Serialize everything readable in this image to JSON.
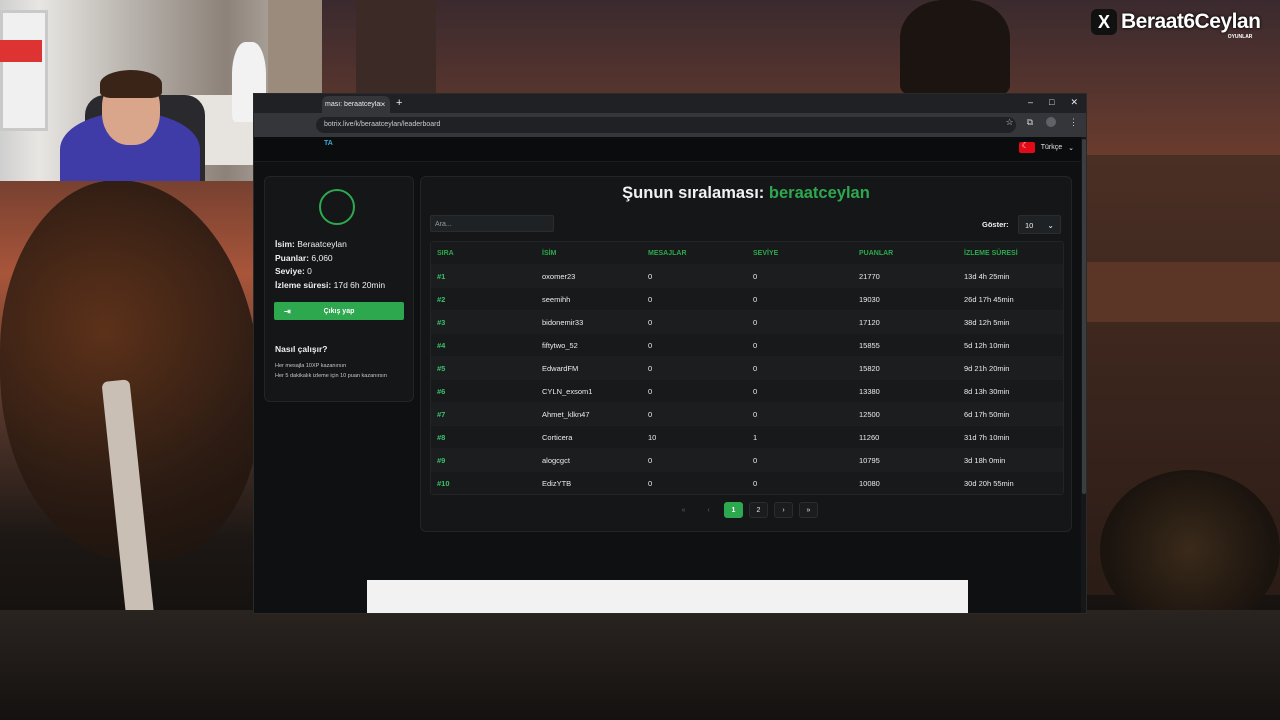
{
  "watermark": {
    "logo": "X",
    "handle": "Beraat6Ceylan",
    "sub": "OYUNLAR"
  },
  "browser": {
    "tab_title": "ması: beraatceylan",
    "tab_close": "×",
    "new_tab": "+",
    "window_controls": [
      "–",
      "□",
      "✕"
    ],
    "url": "botrix.live/k/beraatceylan/leaderboard"
  },
  "topnav": {
    "brand_fragment": "TA",
    "language": "Türkçe"
  },
  "profile": {
    "name_label": "İsim:",
    "name_value": "Beraatceylan",
    "points_label": "Puanlar:",
    "points_value": "6,060",
    "level_label": "Seviye:",
    "level_value": "0",
    "watch_label": "İzleme süresi:",
    "watch_value": "17d 6h 20min",
    "logout_label": "Çıkış yap"
  },
  "how": {
    "title": "Nasıl çalışır?",
    "lines": [
      "Her mesajla 10XP kazanırsın",
      "Her 5 dakikalık izleme için 10 puan kazanırsın"
    ]
  },
  "leaderboard": {
    "title_prefix": "Şunun sıralaması:",
    "title_channel": "beraatceylan",
    "search_placeholder": "Ara...",
    "show_label": "Göster:",
    "show_value": "10",
    "columns": [
      "SIRA",
      "İSİM",
      "MESAJLAR",
      "SEVİYE",
      "PUANLAR",
      "İZLEME SÜRESİ"
    ],
    "rows": [
      [
        "#1",
        "oxomer23",
        "0",
        "0",
        "21770",
        "13d 4h 25min"
      ],
      [
        "#2",
        "seemihh",
        "0",
        "0",
        "19030",
        "26d 17h 45min"
      ],
      [
        "#3",
        "bidonemir33",
        "0",
        "0",
        "17120",
        "38d 12h 5min"
      ],
      [
        "#4",
        "fiftytwo_52",
        "0",
        "0",
        "15855",
        "5d 12h 10min"
      ],
      [
        "#5",
        "EdwardFM",
        "0",
        "0",
        "15820",
        "9d 21h 20min"
      ],
      [
        "#6",
        "CYLN_exsom1",
        "0",
        "0",
        "13380",
        "8d 13h 30min"
      ],
      [
        "#7",
        "Ahmet_klkn47",
        "0",
        "0",
        "12500",
        "6d 17h 50min"
      ],
      [
        "#8",
        "Corticera",
        "10",
        "1",
        "11260",
        "31d 7h 10min"
      ],
      [
        "#9",
        "alogcgct",
        "0",
        "0",
        "10795",
        "3d 18h 0min"
      ],
      [
        "#10",
        "EdizYTB",
        "0",
        "0",
        "10080",
        "30d 20h 55min"
      ]
    ],
    "pagination": [
      "«",
      "‹",
      "1",
      "2",
      "›",
      "»"
    ],
    "current_page": "1"
  }
}
